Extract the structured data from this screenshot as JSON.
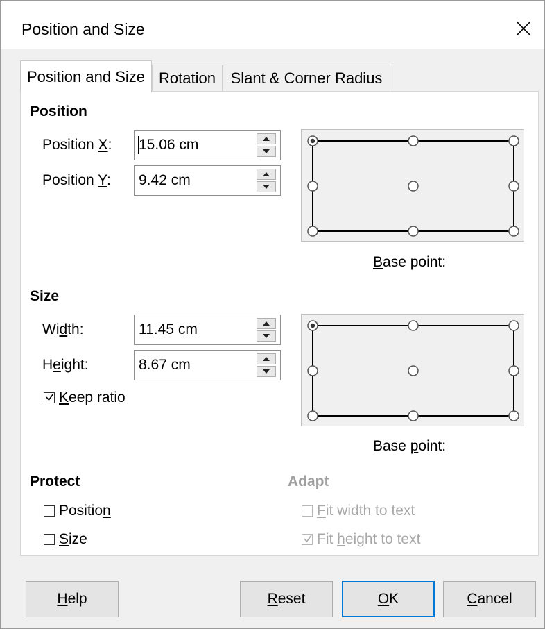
{
  "window": {
    "title": "Position and Size"
  },
  "tabs": [
    {
      "label": "Position and Size",
      "active": true
    },
    {
      "label": "Rotation",
      "active": false
    },
    {
      "label": "Slant & Corner Radius",
      "active": false
    }
  ],
  "position": {
    "title": "Position",
    "x_label_pre": "Position ",
    "x_label_u": "X",
    "x_label_post": ":",
    "x_value": "15.06 cm",
    "y_label_pre": "Position ",
    "y_label_u": "Y",
    "y_label_post": ":",
    "y_value": "9.42 cm",
    "base_label_u": "B",
    "base_label_rest": "ase point:"
  },
  "size": {
    "title": "Size",
    "width_pre": "Wi",
    "width_u": "d",
    "width_post": "th:",
    "width_value": "11.45 cm",
    "height_pre": "H",
    "height_u": "e",
    "height_post": "ight:",
    "height_value": "8.67 cm",
    "keep_u": "K",
    "keep_rest": "eep ratio",
    "keep_checked": true,
    "base_pre": "Base ",
    "base_u": "p",
    "base_post": "oint:"
  },
  "protect": {
    "title": "Protect",
    "position_pre": "Positio",
    "position_u": "n",
    "size_u": "S",
    "size_rest": "ize"
  },
  "adapt": {
    "title": "Adapt",
    "fitw_u": "F",
    "fitw_rest": "it width to text",
    "fith_pre": "Fit ",
    "fith_u": "h",
    "fith_post": "eight to text",
    "fith_checked": true
  },
  "buttons": {
    "help_u": "H",
    "help_rest": "elp",
    "reset_u": "R",
    "reset_rest": "eset",
    "ok_u": "O",
    "ok_rest": "K",
    "cancel_u": "C",
    "cancel_rest": "ancel"
  },
  "colors": {
    "accent": "#0078d7",
    "panel": "#ffffff",
    "dialog_bg": "#f0f0f0",
    "disabled_text": "#a0a0a0"
  }
}
